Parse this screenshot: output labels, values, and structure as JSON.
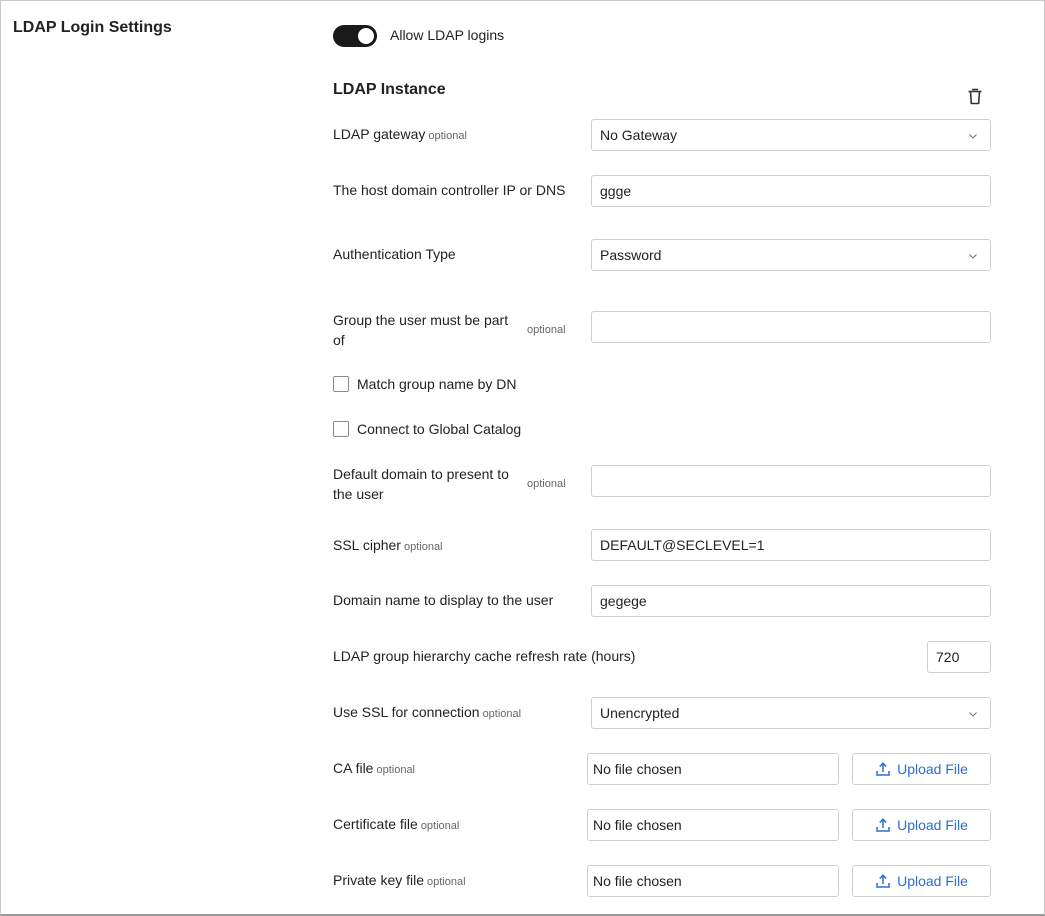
{
  "section_title": "LDAP Login Settings",
  "allow_toggle": {
    "label": "Allow LDAP logins",
    "enabled": true
  },
  "instance_title": "LDAP Instance",
  "optional_text": "optional",
  "gateway": {
    "label": "LDAP gateway",
    "value": "No Gateway"
  },
  "host": {
    "label": "The host domain controller IP or DNS",
    "value": "ggge"
  },
  "auth_type": {
    "label": "Authentication Type",
    "value": "Password"
  },
  "group": {
    "label_line1": "Group the user must be part",
    "label_line2": "of",
    "value": ""
  },
  "match_group": {
    "label": "Match group name by DN",
    "checked": false
  },
  "global_catalog": {
    "label": "Connect to Global Catalog",
    "checked": false
  },
  "default_domain": {
    "label_line1": "Default domain to present to",
    "label_line2": "the user",
    "value": ""
  },
  "ssl_cipher": {
    "label": "SSL cipher",
    "value": "DEFAULT@SECLEVEL=1"
  },
  "domain_display": {
    "label": "Domain name to display to the user",
    "value": "gegege"
  },
  "cache_refresh": {
    "label": "LDAP group hierarchy cache refresh rate (hours)",
    "value": "720"
  },
  "use_ssl": {
    "label": "Use SSL for connection",
    "value": "Unencrypted"
  },
  "ca_file": {
    "label": "CA file",
    "value": "No file chosen",
    "button": "Upload File"
  },
  "cert_file": {
    "label": "Certificate file",
    "value": "No file chosen",
    "button": "Upload File"
  },
  "key_file": {
    "label": "Private key file",
    "value": "No file chosen",
    "button": "Upload File"
  },
  "colors": {
    "accent": "#2a6fd1",
    "toggle_on": "#1a1a1a",
    "border": "#cfcfcf"
  },
  "icons": {
    "trash": "trash-icon",
    "chevron": "chevron-down-icon",
    "upload": "upload-icon"
  }
}
